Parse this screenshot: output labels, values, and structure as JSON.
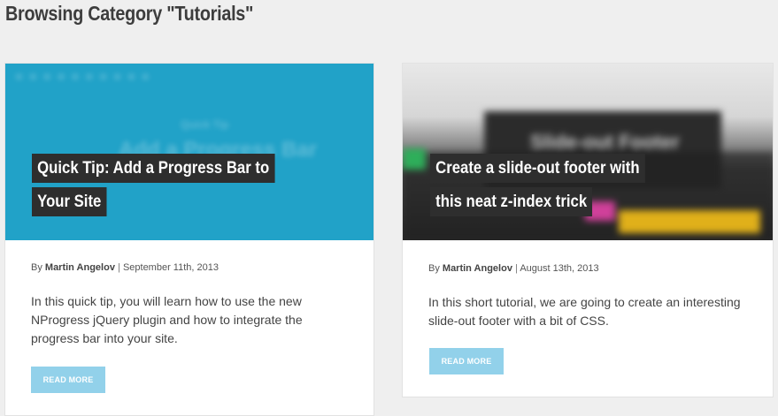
{
  "page": {
    "heading": "Browsing Category \"Tutorials\""
  },
  "posts": [
    {
      "title_lines": [
        "Quick Tip: Add a Progress Bar to",
        "Your Site"
      ],
      "hero_text": [
        "Quick Tip",
        "Add a Progress Bar"
      ],
      "meta_prefix": "By",
      "author": "Martin Angelov",
      "date": "September 11th, 2013",
      "excerpt": "In this quick tip, you will learn how to use the new NProgress jQuery plugin and how to integrate the progress bar into your site.",
      "button": "READ MORE"
    },
    {
      "title_lines": [
        "Create a slide-out footer with",
        "this neat z-index trick"
      ],
      "hero_text": [
        "Slide-out Footer"
      ],
      "meta_prefix": "By",
      "author": "Martin Angelov",
      "date": "August 13th, 2013",
      "excerpt": "In this short tutorial, we are going to create an interesting slide-out footer with a bit of CSS.",
      "button": "READ MORE"
    }
  ],
  "colors": {
    "hero_blue": "#21a2c8",
    "title_bg": "#2e2e2e",
    "button_bg": "#92d1ea",
    "page_bg": "#efefef"
  }
}
